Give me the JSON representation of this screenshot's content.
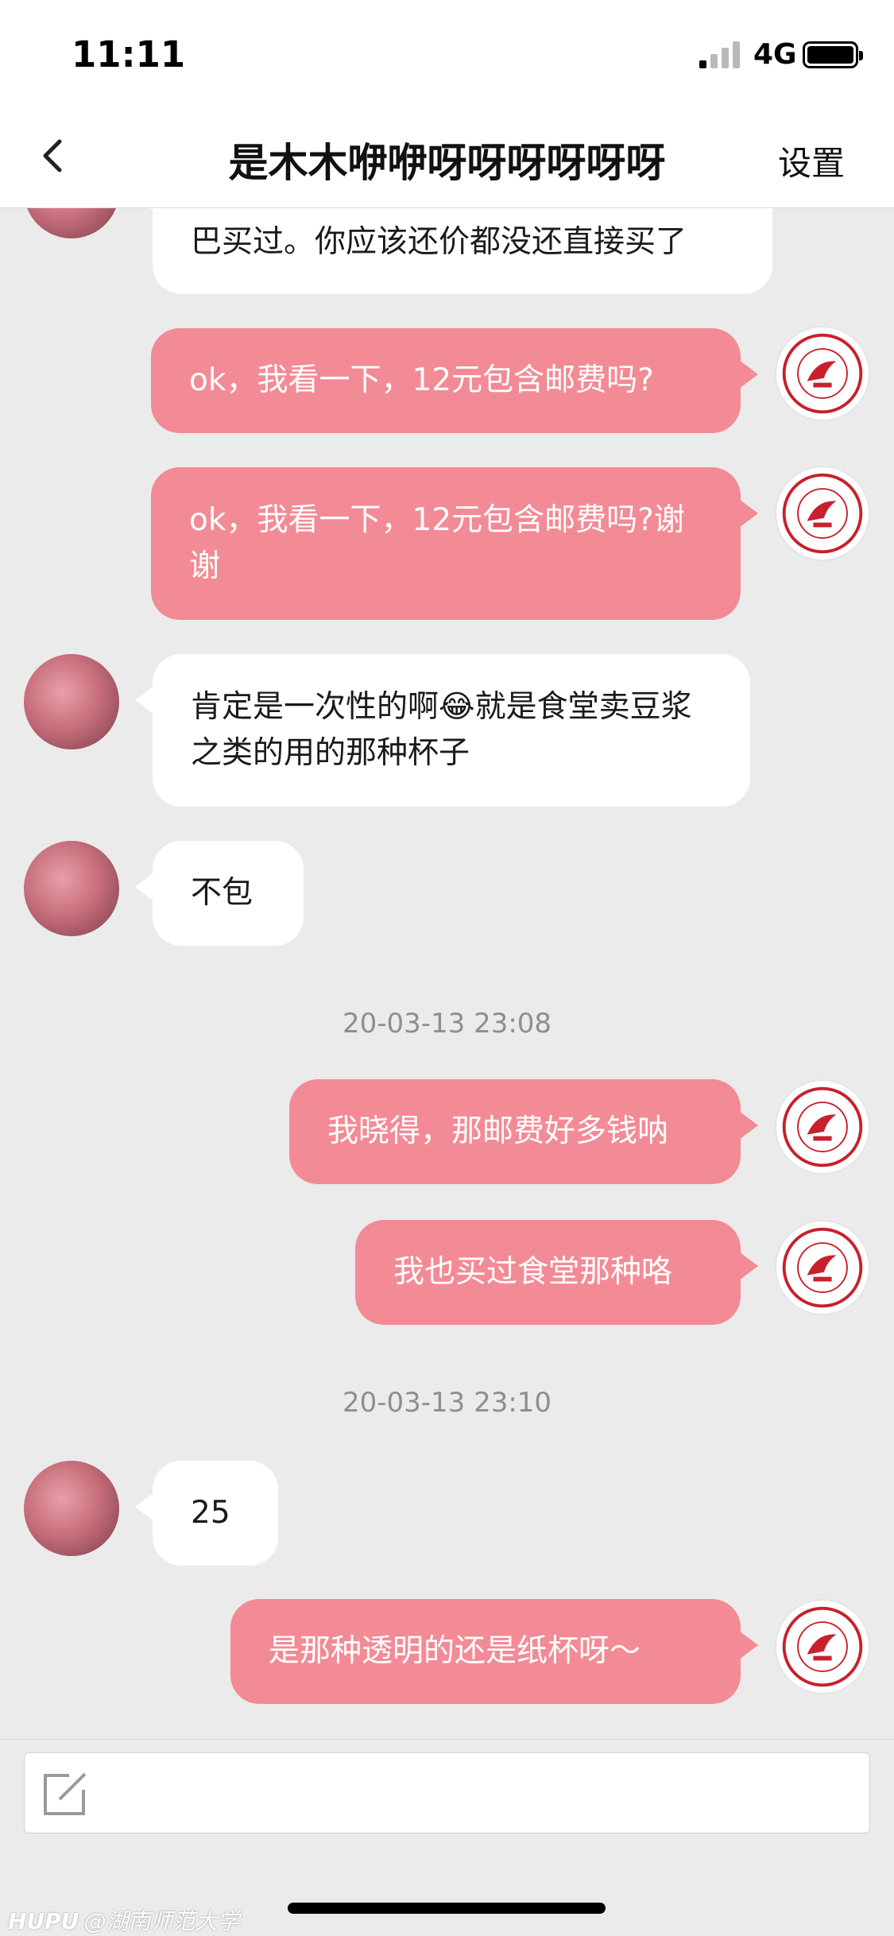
{
  "status_bar": {
    "time": "11:11",
    "network": "4G"
  },
  "header": {
    "title": "是木木咿咿呀呀呀呀呀呀",
    "settings_label": "设置"
  },
  "messages": [
    {
      "sender": "peer",
      "text": "巴买过。你应该还价都没还直接买了"
    },
    {
      "sender": "self",
      "text": "ok，我看一下，12元包含邮费吗?"
    },
    {
      "sender": "self",
      "text": "ok，我看一下，12元包含邮费吗?谢谢"
    },
    {
      "sender": "peer",
      "text": "肯定是一次性的啊😂就是食堂卖豆浆之类的用的那种杯子"
    },
    {
      "sender": "peer",
      "text": "不包"
    },
    {
      "sender": "self",
      "text": "我晓得，那邮费好多钱呐"
    },
    {
      "sender": "self",
      "text": "我也买过食堂那种咯"
    },
    {
      "sender": "peer",
      "text": "25"
    },
    {
      "sender": "self",
      "text": "是那种透明的还是纸杯呀～"
    }
  ],
  "timestamps": [
    "20-03-13 23:08",
    "20-03-13 23:10"
  ],
  "watermark": {
    "brand": "HUPU",
    "handle": "@湖南师范大学"
  },
  "icons": [
    "back-icon",
    "signal-icon",
    "battery-icon",
    "compose-icon",
    "university-logo-icon",
    "user-avatar"
  ],
  "colors": {
    "self_bubble": "#f28b95",
    "peer_bubble": "#ffffff",
    "background": "#ebebeb",
    "logo_red": "#c8202c"
  }
}
